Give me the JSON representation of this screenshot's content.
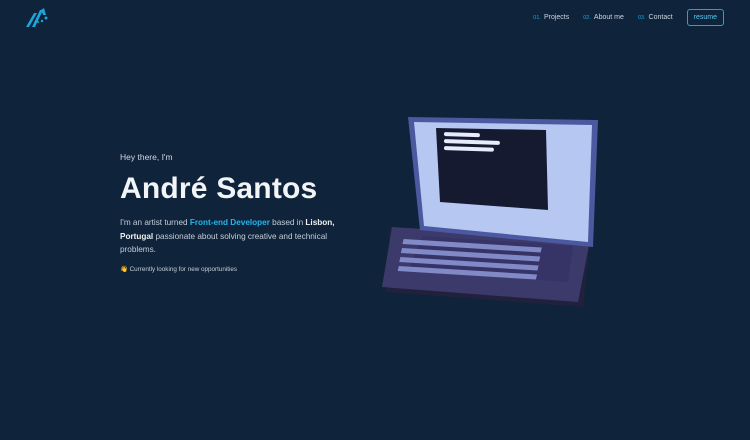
{
  "nav": {
    "items": [
      {
        "num": "01.",
        "label": "Projects"
      },
      {
        "num": "02.",
        "label": "About me"
      },
      {
        "num": "03.",
        "label": "Contact"
      }
    ],
    "resume": "resume"
  },
  "hero": {
    "greeting": "Hey there, I'm",
    "name": "André Santos",
    "desc_1": "I'm an artist turned ",
    "desc_role": "Front-end Developer",
    "desc_2": " based in ",
    "desc_place": "Lisbon, Portugal",
    "desc_3": " passionate about solving creative and technical problems.",
    "status_icon": "👋",
    "status": "Currently looking for new opportunities"
  },
  "colors": {
    "bg": "#0f233a",
    "accent": "#1ea4d8"
  }
}
